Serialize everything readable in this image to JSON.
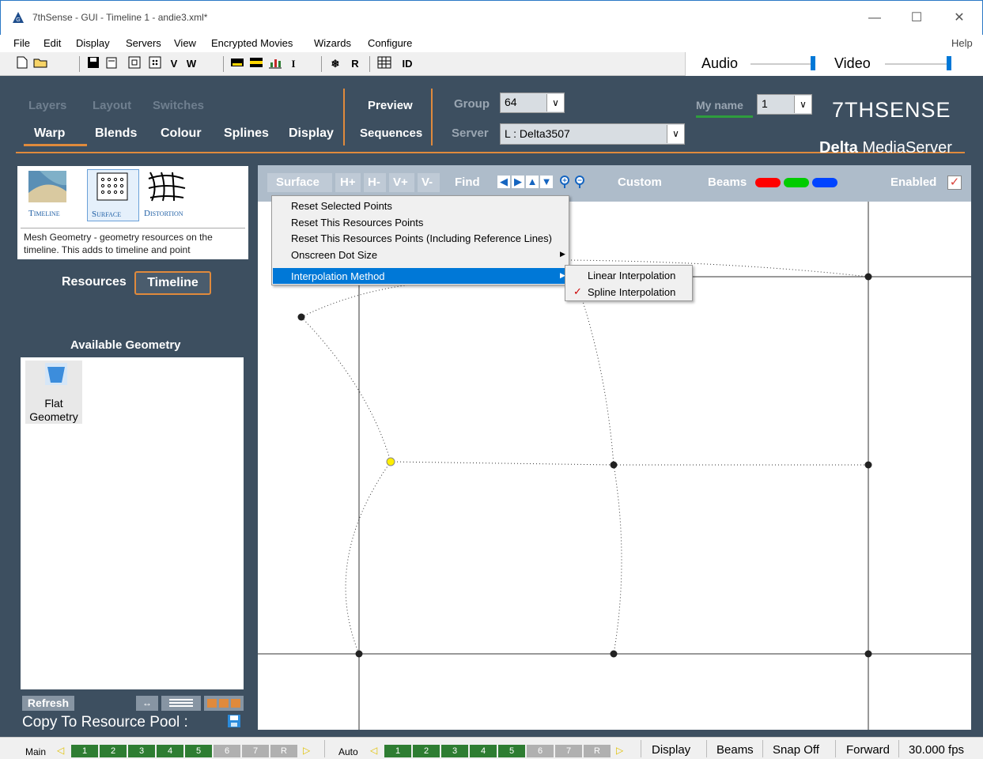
{
  "window": {
    "title": "7thSense - GUI - Timeline 1 - andie3.xml*"
  },
  "menu": [
    "File",
    "Edit",
    "Display",
    "Servers",
    "View",
    "Encrypted Movies",
    "Wizards",
    "Configure"
  ],
  "help_label": "Help",
  "toolbar": {
    "v_label": "V",
    "w_label": "W",
    "i_label": "I",
    "r_label": "R",
    "id_label": "ID"
  },
  "av": {
    "audio_label": "Audio",
    "video_label": "Video"
  },
  "nav": {
    "layers": "Layers",
    "layout": "Layout",
    "switches": "Switches",
    "warp": "Warp",
    "blends": "Blends",
    "colour": "Colour",
    "splines": "Splines",
    "display": "Display",
    "preview": "Preview",
    "sequences": "Sequences",
    "group_label": "Group",
    "group_value": "64",
    "server_label": "Server",
    "server_value": "L : Delta3507",
    "myname_label": "My name",
    "myname_value": "1"
  },
  "brand": {
    "logo": "7THSENSE",
    "product_bold": "Delta",
    "product_rest": "MediaServer"
  },
  "modes": {
    "timeline": "Timeline",
    "surface": "Surface",
    "distortion": "Distortion"
  },
  "description": "Mesh Geometry - geometry resources on the timeline. This adds to timeline and point",
  "resources": {
    "label": "Resources",
    "timeline_btn": "Timeline"
  },
  "geometry": {
    "header": "Available Geometry",
    "item": "Flat Geometry"
  },
  "bottom_left": {
    "refresh": "Refresh",
    "copy": "Copy To Resource Pool :"
  },
  "canvas_toolbar": {
    "surface": "Surface",
    "hplus": "H+",
    "hminus": "H-",
    "vplus": "V+",
    "vminus": "V-",
    "find": "Find",
    "custom": "Custom",
    "beams": "Beams",
    "enabled": "Enabled"
  },
  "context_menu": {
    "items": [
      "Reset Selected Points",
      "Reset This Resources Points",
      "Reset This Resources Points (Including Reference Lines)",
      "Onscreen Dot Size",
      "Interpolation Method"
    ],
    "submenu": [
      "Linear Interpolation",
      "Spline Interpolation"
    ]
  },
  "statusbar": {
    "main": "Main",
    "auto": "Auto",
    "main_nums": [
      "1",
      "2",
      "3",
      "4",
      "5",
      "6",
      "7",
      "R"
    ],
    "auto_nums": [
      "1",
      "2",
      "3",
      "4",
      "5",
      "6",
      "7",
      "R"
    ],
    "display": "Display",
    "beams": "Beams",
    "snap": "Snap Off",
    "forward": "Forward",
    "fps": "30.000 fps"
  },
  "colors": {
    "accent_orange": "#e08a3c",
    "dark_bg": "#3d4f60",
    "selection_blue": "#0078d7",
    "beam_red": "#ff0000",
    "beam_green": "#00cc00",
    "beam_blue": "#0044ff"
  }
}
